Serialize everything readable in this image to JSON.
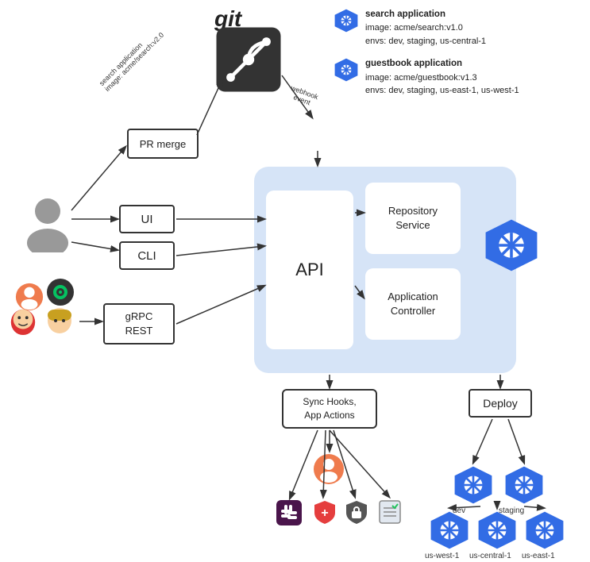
{
  "git": {
    "label": "git"
  },
  "apps": {
    "search": {
      "name": "search application",
      "image": "image: acme/search:v1.0",
      "envs": "envs: dev, staging, us-central-1"
    },
    "guestbook": {
      "name": "guestbook application",
      "image": "image: acme/guestbook:v1.3",
      "envs": "envs: dev, staging, us-east-1, us-west-1"
    }
  },
  "boxes": {
    "ui": "UI",
    "cli": "CLI",
    "grpc": "gRPC\nREST",
    "pr_merge": "PR merge",
    "api": "API",
    "repo_service": "Repository\nService",
    "app_controller": "Application\nController",
    "sync_hooks": "Sync Hooks,\nApp Actions",
    "deploy": "Deploy"
  },
  "k8s_labels": {
    "dev": "dev",
    "staging": "staging",
    "us_west": "us-west-1",
    "us_central": "us-central-1",
    "us_east": "us-east-1"
  },
  "git_arrow_label": "search application\nimage: acme/search:v2.0",
  "webhook_label": "webhook\nevent"
}
